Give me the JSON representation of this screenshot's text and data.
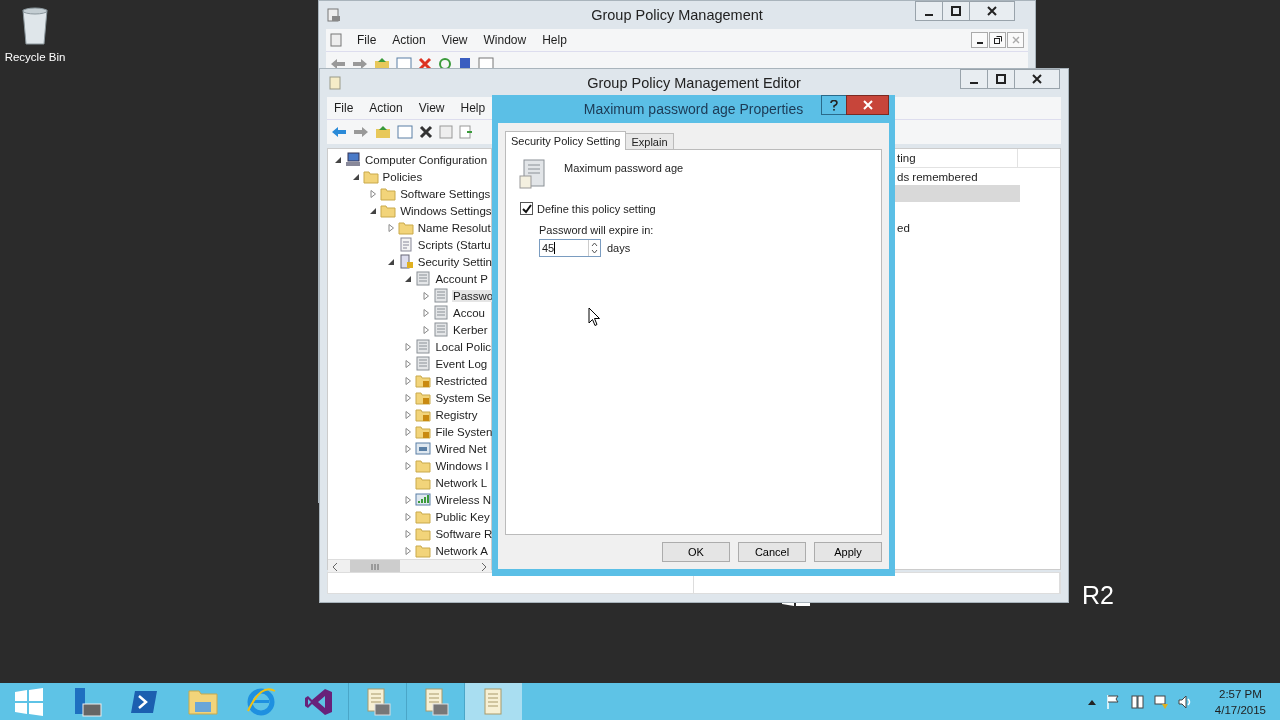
{
  "desktop": {
    "icons": [
      {
        "label": "Recycle Bin"
      }
    ],
    "branding": "R2"
  },
  "gpm_window": {
    "title": "Group Policy Management",
    "menu": [
      "File",
      "Action",
      "View",
      "Window",
      "Help"
    ]
  },
  "editor_window": {
    "title": "Group Policy Management Editor",
    "menu": [
      "File",
      "Action",
      "View",
      "Help"
    ],
    "tree": [
      {
        "label": "Computer Configuration",
        "expanded": true,
        "kind": "computer",
        "selected": false,
        "children": [
          {
            "label": "Policies",
            "expanded": true,
            "kind": "folder",
            "selected": false,
            "children": [
              {
                "label": "Software Settings",
                "expanded": false,
                "kind": "folder",
                "selected": false
              },
              {
                "label": "Windows Settings",
                "expanded": true,
                "kind": "folder",
                "selected": false,
                "children": [
                  {
                    "label": "Name Resolut",
                    "expanded": false,
                    "kind": "folder",
                    "selected": false
                  },
                  {
                    "label": "Scripts (Startu",
                    "kind": "script",
                    "selected": false
                  },
                  {
                    "label": "Security Settin",
                    "expanded": true,
                    "kind": "security",
                    "selected": false,
                    "children": [
                      {
                        "label": "Account P",
                        "expanded": true,
                        "kind": "policy",
                        "selected": false,
                        "children": [
                          {
                            "label": "Passwo",
                            "expanded": false,
                            "kind": "policy",
                            "selected": true
                          },
                          {
                            "label": "Accou",
                            "expanded": false,
                            "kind": "policy",
                            "selected": false
                          },
                          {
                            "label": "Kerber",
                            "expanded": false,
                            "kind": "policy",
                            "selected": false
                          }
                        ]
                      },
                      {
                        "label": "Local Polic",
                        "expanded": false,
                        "kind": "policy",
                        "selected": false
                      },
                      {
                        "label": "Event Log",
                        "expanded": false,
                        "kind": "policy",
                        "selected": false
                      },
                      {
                        "label": "Restricted",
                        "expanded": false,
                        "kind": "lockfolder",
                        "selected": false
                      },
                      {
                        "label": "System Se",
                        "expanded": false,
                        "kind": "lockfolder",
                        "selected": false
                      },
                      {
                        "label": "Registry",
                        "expanded": false,
                        "kind": "lockfolder",
                        "selected": false
                      },
                      {
                        "label": "File Systen",
                        "expanded": false,
                        "kind": "lockfolder",
                        "selected": false
                      },
                      {
                        "label": "Wired Net",
                        "expanded": false,
                        "kind": "wired",
                        "selected": false
                      },
                      {
                        "label": "Windows I",
                        "expanded": false,
                        "kind": "folder",
                        "selected": false
                      },
                      {
                        "label": "Network L",
                        "kind": "folder",
                        "selected": false
                      },
                      {
                        "label": "Wireless N",
                        "expanded": false,
                        "kind": "wireless",
                        "selected": false
                      },
                      {
                        "label": "Public Key",
                        "expanded": false,
                        "kind": "folder",
                        "selected": false
                      },
                      {
                        "label": "Software R",
                        "expanded": false,
                        "kind": "folder",
                        "selected": false
                      },
                      {
                        "label": "Network A",
                        "expanded": false,
                        "kind": "folder",
                        "selected": false
                      }
                    ]
                  }
                ]
              }
            ]
          }
        ]
      }
    ],
    "details": {
      "column_1": "ting",
      "rows": [
        {
          "text": "ds remembered",
          "selected": false
        },
        {
          "selected": true
        },
        {
          "text": "ed",
          "selected": false
        }
      ]
    }
  },
  "dialog": {
    "title": "Maximum password age Properties",
    "tabs": [
      {
        "label": "Security Policy Setting",
        "selected": true
      },
      {
        "label": "Explain",
        "selected": false
      }
    ],
    "policy_name": "Maximum password age",
    "define": {
      "label": "Define this policy setting",
      "checked": true
    },
    "expire_label": "Password will expire in:",
    "value": "45",
    "unit": "days",
    "buttons": [
      "OK",
      "Cancel",
      "Apply"
    ]
  },
  "taskbar": {
    "apps": [
      {
        "kind": "start",
        "active": false
      },
      {
        "kind": "server",
        "active": false
      },
      {
        "kind": "shell",
        "active": false
      },
      {
        "kind": "explorer",
        "active": false
      },
      {
        "kind": "browser",
        "active": false
      },
      {
        "kind": "studio",
        "active": false
      },
      {
        "kind": "gpm",
        "active": false
      },
      {
        "kind": "gpm",
        "active": false
      },
      {
        "kind": "scroll",
        "active": true
      }
    ],
    "time": "2:57 PM",
    "date": "4/17/2015"
  }
}
